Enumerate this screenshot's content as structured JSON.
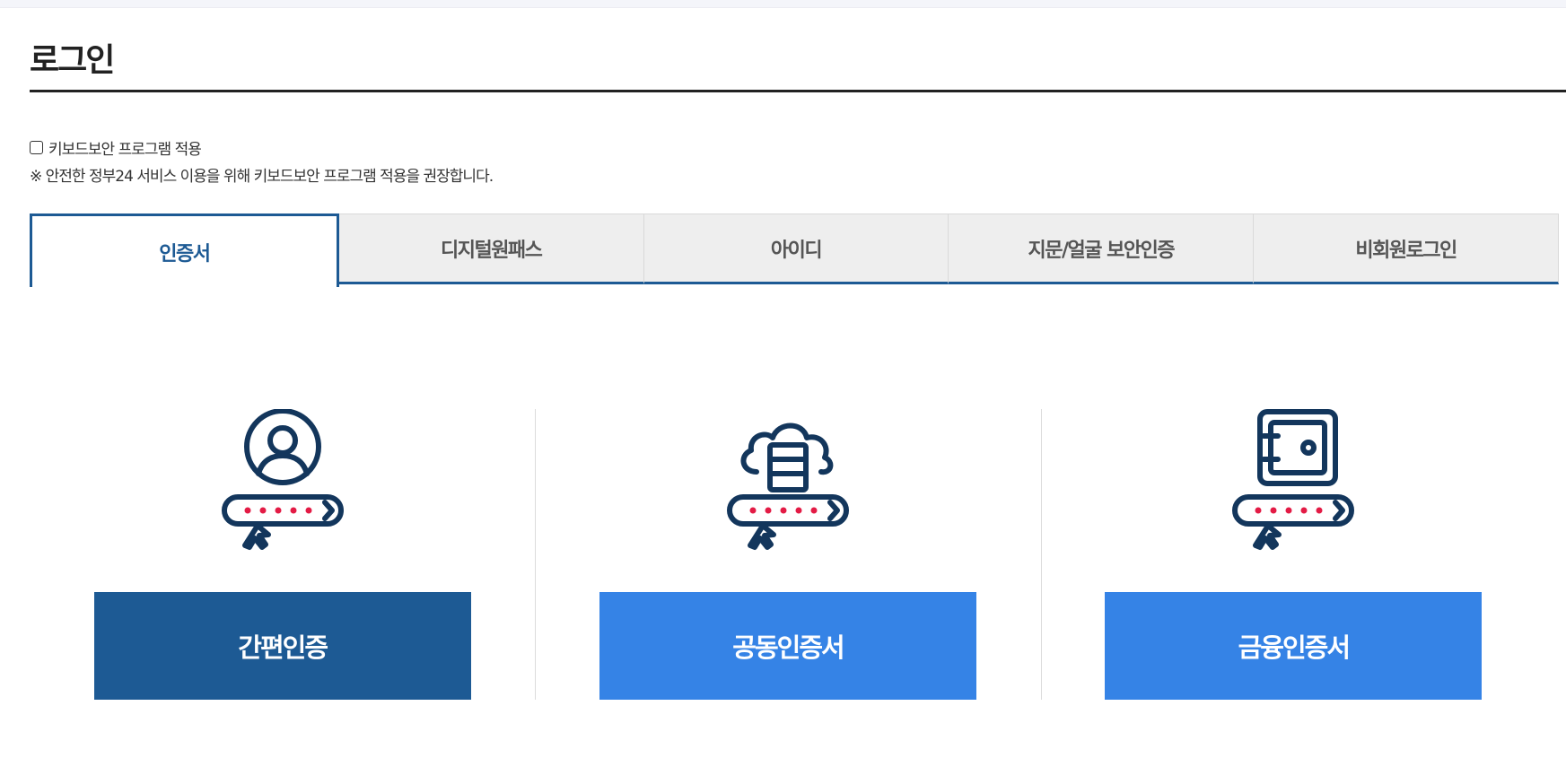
{
  "page": {
    "title": "로그인"
  },
  "keyboard_security": {
    "checkbox_label": "키보드보안 프로그램 적용",
    "notice": "※ 안전한 정부24 서비스 이용을 위해 키보드보안 프로그램 적용을 권장합니다."
  },
  "tabs": [
    {
      "label": "인증서",
      "active": true
    },
    {
      "label": "디지털원패스",
      "active": false
    },
    {
      "label": "아이디",
      "active": false
    },
    {
      "label": "지문/얼굴 보안인증",
      "active": false
    },
    {
      "label": "비회원로그인",
      "active": false
    }
  ],
  "methods": [
    {
      "label": "간편인증",
      "icon": "user-password-icon",
      "color": "#1d5a94"
    },
    {
      "label": "공동인증서",
      "icon": "cloud-server-password-icon",
      "color": "#3583e6"
    },
    {
      "label": "금융인증서",
      "icon": "safe-password-icon",
      "color": "#3583e6"
    }
  ],
  "colors": {
    "primary_navy": "#1d5a94",
    "accent_blue": "#3583e6",
    "icon_stroke": "#13365c",
    "password_dots": "#e31b45",
    "tab_inactive_bg": "#eeeeee"
  }
}
